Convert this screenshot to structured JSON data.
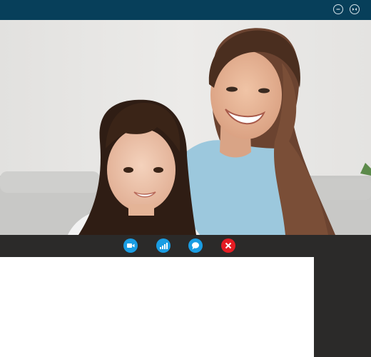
{
  "window": {
    "controls": [
      {
        "name": "minimize",
        "icon": "minus-circle-icon"
      },
      {
        "name": "fullscreen",
        "icon": "fullscreen-circle-icon"
      }
    ]
  },
  "video": {
    "description_icon": "video-feed",
    "colors": {
      "wall": "#e9e7e4",
      "sofa": "#c9c9c7",
      "woman_shirt": "#9cc8dd",
      "hair_dark": "#3a2417",
      "hair_brown": "#6b4330",
      "skin": "#e8b99c"
    }
  },
  "toolbar": {
    "buttons": [
      {
        "name": "camera",
        "icon": "video-camera-icon",
        "color": "#1a9de3"
      },
      {
        "name": "signal",
        "icon": "signal-bars-icon",
        "color": "#1a9de3"
      },
      {
        "name": "chat",
        "icon": "chat-bubble-icon",
        "color": "#1a9de3"
      },
      {
        "name": "end-call",
        "icon": "close-icon",
        "color": "#e51c23"
      }
    ]
  },
  "colors": {
    "title_bar": "#073f5a",
    "toolbar": "#2b2a29",
    "side_panel": "#2b2a29",
    "content": "#ffffff"
  }
}
